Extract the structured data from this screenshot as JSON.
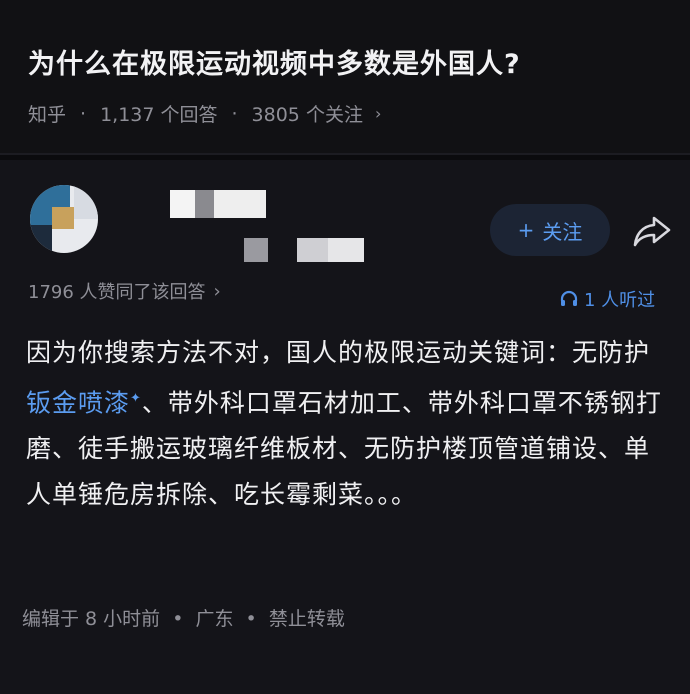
{
  "question": {
    "title": "为什么在极限运动视频中多数是外国人?",
    "source": "知乎",
    "answers": "1,137 个回答",
    "followers": "3805 个关注"
  },
  "answer": {
    "follow_label": "关注",
    "likes": "1796 人赞同了该回答",
    "listen": "1 人听过",
    "content_before": "因为你搜索方法不对，国人的极限运动关键词：无防护",
    "keyword": "钣金喷漆",
    "content_after": "、带外科口罩石材加工、带外科口罩不锈钢打磨、徒手搬运玻璃纤维板材、无防护楼顶管道铺设、单人单锤危房拆除、吃长霉剩菜。。。",
    "edited": "编辑于 8 小时前",
    "location": "广东",
    "copyright": "禁止转载"
  },
  "colors": {
    "background": "#0b0b0e",
    "card": "#141419",
    "accent_blue": "#5b9cf0",
    "muted_text": "#8f8f97"
  },
  "icons": [
    "chevron-right-icon",
    "plus-icon",
    "share-icon",
    "headphones-icon",
    "keyword-sparkle-icon"
  ]
}
